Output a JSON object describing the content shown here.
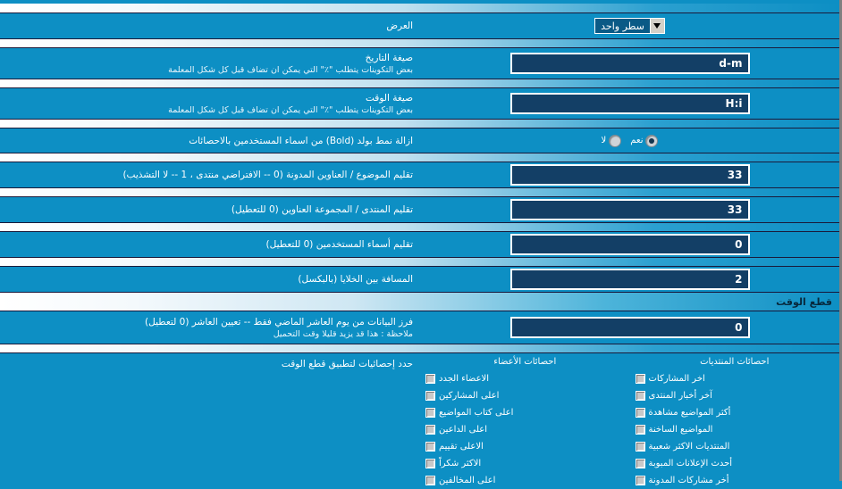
{
  "rows": {
    "display": {
      "label": "العرض",
      "select_value": "سطر واحد",
      "arrow_icon": "chevron-down-icon"
    },
    "date_format": {
      "label": "صيغة التاريخ",
      "desc": "بعض التكوينات يتطلب \"٪\" التي يمكن ان تضاف قبل كل شكل المعلمة",
      "value": "d-m"
    },
    "time_format": {
      "label": "صيغة الوقت",
      "desc": "بعض التكوينات يتطلب \"٪\" التي يمكن ان تضاف قبل كل شكل المعلمة",
      "value": "H:i"
    },
    "bold_removal": {
      "label": "ازالة نمط بولد (Bold) من اسماء المستخدمين بالاحصائات",
      "options": [
        {
          "label": "نعم",
          "selected": true
        },
        {
          "label": "لا",
          "selected": false
        }
      ]
    },
    "trim_topic": {
      "label": "تقليم الموضوع / العناوين المدونة (0 -- الافتراضي منتدى ، 1 -- لا التشذيب)",
      "value": "33"
    },
    "trim_forum": {
      "label": "تقليم المنتدى / المجموعة العناوين (0 للتعطيل)",
      "value": "33"
    },
    "trim_usernames": {
      "label": "تقليم أسماء المستخدمين (0 للتعطيل)",
      "value": "0"
    },
    "cell_spacing": {
      "label": "المسافة بين الخلايا (بالبكسل)",
      "value": "2"
    }
  },
  "section_timecut": {
    "title": "قطع الوقت",
    "sort_row": {
      "label": "فرز البيانات من يوم العاشر الماضي فقط -- تعيين العاشر (0 لتعطيل)",
      "desc": "ملاحظة : هذا قد يزيد قليلا وقت التحميل",
      "value": "0"
    },
    "choose_label": "حدد إحصائيات لتطبيق قطع الوقت",
    "columns": [
      {
        "header": "احصائات المنتديات",
        "items": [
          {
            "label": "اخر المشاركات",
            "checked": false
          },
          {
            "label": "آخر أخبار المنتدى",
            "checked": false
          },
          {
            "label": "أكثر المواضيع مشاهدة",
            "checked": false
          },
          {
            "label": "المواضيع الساخنة",
            "checked": false
          },
          {
            "label": "المنتديات الاكثر شعبية",
            "checked": false
          },
          {
            "label": "أحدث الإعلانات المبوبة",
            "checked": false
          },
          {
            "label": "أخر مشاركات المدونة",
            "checked": false
          }
        ]
      },
      {
        "header": "احصائات الأعضاء",
        "items": [
          {
            "label": "الاعضاء الجدد",
            "checked": false
          },
          {
            "label": "اعلى المشاركين",
            "checked": false
          },
          {
            "label": "اعلى كتاب المواضيع",
            "checked": false
          },
          {
            "label": "اعلى الداعين",
            "checked": false
          },
          {
            "label": "الاعلى تقييم",
            "checked": false
          },
          {
            "label": "الاكثر شكراً",
            "checked": false
          },
          {
            "label": "اعلى المخالفين",
            "checked": false
          }
        ]
      }
    ]
  }
}
